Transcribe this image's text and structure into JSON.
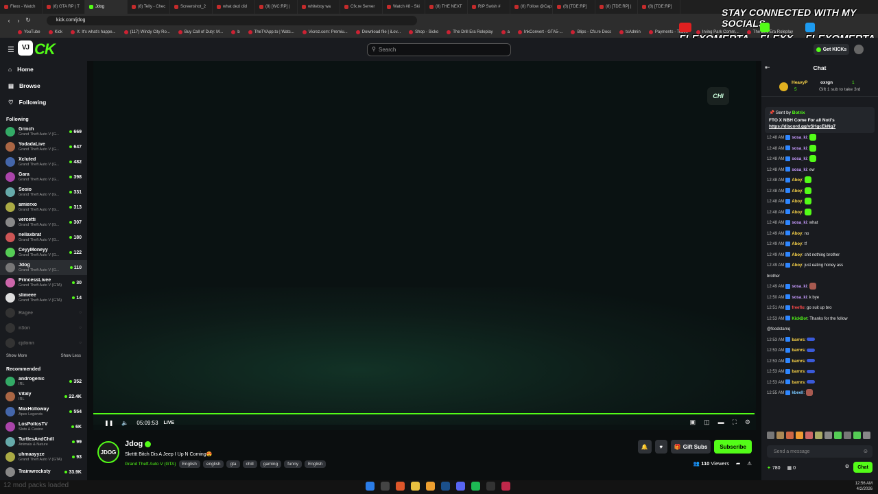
{
  "browser": {
    "tabs": [
      "Flexx - Watch",
      "(8) GTA RP | T",
      "Jdog",
      "(8) Telly - Chec",
      "Screenshot_2",
      "what dezi did",
      "(8) [WC:RP] |",
      "whiteboy wa",
      "Cfx.re Server",
      "Watch #8 - Ski",
      "(8) THE NEXT",
      "RIP Swish #",
      "(8) Follow @Cap",
      "(8) [TDE:RP]",
      "(8) [TDE:RP] |",
      "(8) [TDE:RP]"
    ],
    "active_tab": 2,
    "url": "kick.com/jdog",
    "bookmarks": [
      "YouTube",
      "Kick",
      "X: It's what's happe...",
      "(117) Windy City Ro...",
      "Buy Call of Duty: M...",
      "b",
      "TheTVApp.to | Watc...",
      "Vicrez.com: Premiu...",
      "Download file | iLov...",
      "Shop - Sicko",
      "The Drill Era Roleplay",
      "a",
      "InkConvert - GTA5-...",
      "Blips - Cfx.re Docs",
      "txAdmin",
      "Payments - Tebex",
      "Irving Park Comm...",
      "The Drill Era Roleplay"
    ]
  },
  "overlay": {
    "heading": "STAY CONNECTED WITH MY SOCIALS",
    "socials": [
      "FLEXOMERTA",
      "FLEXX",
      "FLEXOMERTA"
    ]
  },
  "header": {
    "logo_badge": "VJ",
    "logo_text": "CK",
    "search_placeholder": "Search",
    "get_kicks": "Get KICKs"
  },
  "sidebar": {
    "nav": [
      {
        "label": "Home",
        "icon": "home-icon"
      },
      {
        "label": "Browse",
        "icon": "browse-icon"
      },
      {
        "label": "Following",
        "icon": "heart-icon"
      }
    ],
    "following_title": "Following",
    "following": [
      {
        "name": "Grinch",
        "game": "Grand Theft Auto V (G...",
        "viewers": "669"
      },
      {
        "name": "YodadaLive",
        "game": "Grand Theft Auto V (G...",
        "viewers": "647"
      },
      {
        "name": "Xcluted",
        "game": "Grand Theft Auto V (G...",
        "viewers": "482"
      },
      {
        "name": "Gara",
        "game": "Grand Theft Auto V (G...",
        "viewers": "398"
      },
      {
        "name": "Sosio",
        "game": "Grand Theft Auto V (G...",
        "viewers": "331"
      },
      {
        "name": "amierxo",
        "game": "Grand Theft Auto V (G...",
        "viewers": "313"
      },
      {
        "name": "vercetti",
        "game": "Grand Theft Auto V (G...",
        "viewers": "307"
      },
      {
        "name": "nellaxbrat",
        "game": "Grand Theft Auto V (G...",
        "viewers": "180"
      },
      {
        "name": "CeyyMoneyy",
        "game": "Grand Theft Auto V (G...",
        "viewers": "122"
      },
      {
        "name": "Jdog",
        "game": "Grand Theft Auto V (G...",
        "viewers": "110"
      },
      {
        "name": "PrincessLivee",
        "game": "Grand Theft Auto V (GTA)",
        "viewers": "30"
      },
      {
        "name": "slimeee",
        "game": "Grand Theft Auto V (GTA)",
        "viewers": "14"
      }
    ],
    "offline": [
      "Ragee",
      "n3on",
      "cjdonn"
    ],
    "show_more": "Show More",
    "show_less": "Show Less",
    "recommended_title": "Recommended",
    "recommended": [
      {
        "name": "androgenic",
        "game": "IRL",
        "viewers": "352"
      },
      {
        "name": "Vitaly",
        "game": "IRL",
        "viewers": "22.4K"
      },
      {
        "name": "MaxHolloway",
        "game": "Apex Legends",
        "viewers": "554"
      },
      {
        "name": "LosPollosTV",
        "game": "Slots & Casino",
        "viewers": "6K"
      },
      {
        "name": "TurtlesAndChill",
        "game": "Animals & Nature",
        "viewers": "99"
      },
      {
        "name": "uhmaayyze",
        "game": "Grand Theft Auto V (GTA)",
        "viewers": "93"
      },
      {
        "name": "Trainwrecksty",
        "game": "",
        "viewers": "33.9K"
      }
    ]
  },
  "player": {
    "time": "05:09:53",
    "live_label": "LIVE",
    "logo": "CHI"
  },
  "stream": {
    "avatar_text": "JDOG",
    "name": "Jdog",
    "title": "Skrtttt Bitch Dis A Jeep I Up N Coming😍",
    "category": "Grand Theft Auto V (GTA)",
    "tags": [
      "English",
      "english",
      "gta",
      "chill",
      "gaming",
      "funny",
      "English"
    ],
    "gift_subs": "Gift Subs",
    "subscribe": "Subscribe",
    "viewers": "110",
    "viewers_label": "Viewers"
  },
  "chat": {
    "title": "Chat",
    "gifter_name": "HeavyP",
    "gifter_count": "5",
    "gifter2": "oxrgn",
    "gifter2_count": "1",
    "gifter_note": "Gift 1 sub to take 3rd",
    "pin_sender_label": "Sent by",
    "pin_sender": "Botrix",
    "pin_text": "FTO X NBH Come For all Noti's",
    "pin_link": "https://discord.gg/vSHgcEkNg7",
    "messages": [
      {
        "t": "12:48 AM",
        "u": "sosa_ki",
        "c": "#c79bff",
        "text": "",
        "emote": "green"
      },
      {
        "t": "12:48 AM",
        "u": "sosa_ki",
        "c": "#c79bff",
        "text": "",
        "emote": "green"
      },
      {
        "t": "12:48 AM",
        "u": "sosa_ki",
        "c": "#c79bff",
        "text": "",
        "emote": "green"
      },
      {
        "t": "12:48 AM",
        "u": "sosa_ki",
        "c": "#c79bff",
        "text": "ew",
        "emote": ""
      },
      {
        "t": "12:48 AM",
        "u": "Aboy",
        "c": "#ffd84a",
        "text": "",
        "emote": "green"
      },
      {
        "t": "12:48 AM",
        "u": "Aboy",
        "c": "#ffd84a",
        "text": "",
        "emote": "green"
      },
      {
        "t": "12:48 AM",
        "u": "Aboy",
        "c": "#ffd84a",
        "text": "",
        "emote": "green"
      },
      {
        "t": "12:48 AM",
        "u": "Aboy",
        "c": "#ffd84a",
        "text": "",
        "emote": "green"
      },
      {
        "t": "12:48 AM",
        "u": "sosa_ki",
        "c": "#c79bff",
        "text": "what",
        "emote": ""
      },
      {
        "t": "12:49 AM",
        "u": "Aboy",
        "c": "#ffd84a",
        "text": "no",
        "emote": ""
      },
      {
        "t": "12:49 AM",
        "u": "Aboy",
        "c": "#ffd84a",
        "text": "tf",
        "emote": ""
      },
      {
        "t": "12:49 AM",
        "u": "Aboy",
        "c": "#ffd84a",
        "text": "shit nothing brother",
        "emote": ""
      },
      {
        "t": "12:49 AM",
        "u": "Aboy",
        "c": "#ffd84a",
        "text": "just eating honey ass",
        "emote": ""
      },
      {
        "t": "",
        "u": "",
        "c": "#eee",
        "text": "brother",
        "emote": ""
      },
      {
        "t": "12:49 AM",
        "u": "sosa_ki",
        "c": "#c79bff",
        "text": "",
        "emote": "img"
      },
      {
        "t": "12:50 AM",
        "u": "sosa_ki",
        "c": "#c79bff",
        "text": "k bye",
        "emote": ""
      },
      {
        "t": "12:51 AM",
        "u": "freeflo",
        "c": "#ff4a4a",
        "text": "go suit up bro",
        "emote": ""
      },
      {
        "t": "12:53 AM",
        "u": "KickBot",
        "c": "#53fc18",
        "text": "Thanks for the follow",
        "emote": ""
      },
      {
        "t": "",
        "u": "",
        "c": "#eee",
        "text": "@foodstamq",
        "emote": ""
      },
      {
        "t": "12:53 AM",
        "u": "barnrs",
        "c": "#ffd84a",
        "text": "",
        "emote": "kk"
      },
      {
        "t": "12:53 AM",
        "u": "barnrs",
        "c": "#ffd84a",
        "text": "",
        "emote": "kk"
      },
      {
        "t": "12:53 AM",
        "u": "barnrs",
        "c": "#ffd84a",
        "text": "",
        "emote": "kk"
      },
      {
        "t": "12:53 AM",
        "u": "barnrs",
        "c": "#ffd84a",
        "text": "",
        "emote": "kk"
      },
      {
        "t": "12:53 AM",
        "u": "barnrs",
        "c": "#ffd84a",
        "text": "",
        "emote": "kk"
      },
      {
        "t": "12:55 AM",
        "u": "kbeell",
        "c": "#7ac8ff",
        "text": "",
        "emote": "img"
      }
    ],
    "input_placeholder": "Send a message",
    "points": "780",
    "zero": "0",
    "chat_button": "Chat"
  },
  "taskbar": {
    "status": "12 mod packs loaded",
    "time": "12:56 AM",
    "date": "4/2/2026"
  },
  "colors": {
    "accent": "#53fc18",
    "panel": "#191b1f",
    "bg": "#0b0e0f"
  }
}
